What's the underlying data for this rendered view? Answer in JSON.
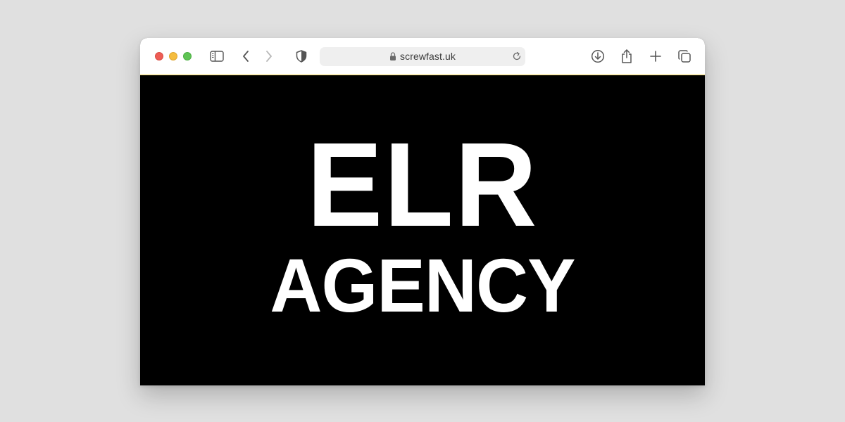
{
  "browser": {
    "address_bar": {
      "url": "screwfast.uk"
    },
    "toolbar_icons": [
      "sidebar-icon",
      "back-chevron-icon",
      "forward-chevron-icon",
      "shield-icon",
      "lock-icon",
      "reload-icon",
      "download-icon",
      "share-icon",
      "plus-icon",
      "tabs-icon"
    ],
    "traffic_light_colors": {
      "close": "#ee5d55",
      "minimize": "#f5bd3f",
      "maximize": "#5fc454"
    }
  },
  "page": {
    "background": "#000000",
    "text_color": "#ffffff",
    "logo_line1": "ELR",
    "logo_line2": "AGENCY"
  }
}
